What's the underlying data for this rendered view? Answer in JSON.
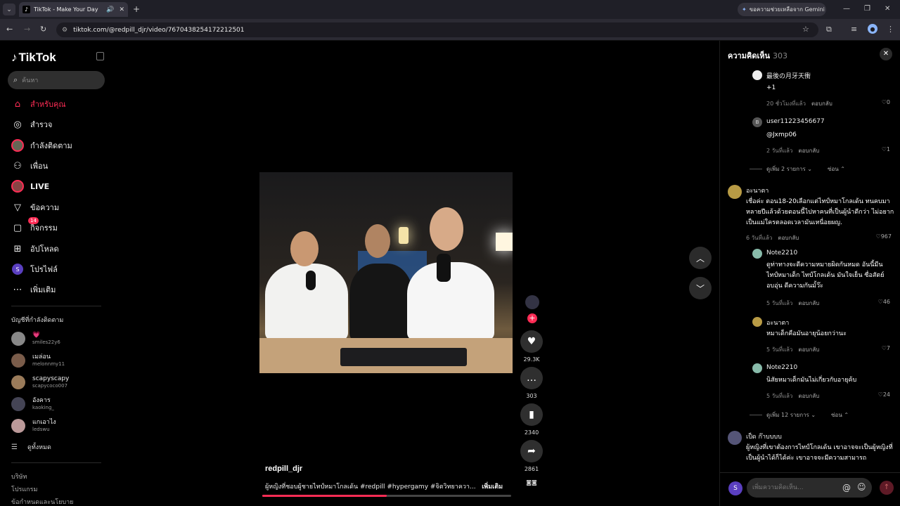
{
  "browser": {
    "tab_title": "TikTok - Make Your Day",
    "url": "tiktok.com/@redpill_djr/video/7670438254172212501",
    "gemini_label": "ขอความช่วยเหลือจาก Gemini"
  },
  "sidebar": {
    "logo_text": "TikTok",
    "search_placeholder": "ค้นหา",
    "nav": [
      {
        "label": "สำหรับคุณ"
      },
      {
        "label": "สำรวจ"
      },
      {
        "label": "กำลังติดตาม"
      },
      {
        "label": "เพื่อน"
      },
      {
        "label": "LIVE"
      },
      {
        "label": "ข้อความ"
      },
      {
        "label": "กิจกรรม",
        "badge": "14"
      },
      {
        "label": "อัปโหลด"
      },
      {
        "label": "โปรไฟล์",
        "initial": "S"
      },
      {
        "label": "เพิ่มเติม"
      }
    ],
    "following_title": "บัญชีที่กำลังติดตาม",
    "following": [
      {
        "name": "💗",
        "handle": "smiles22y6"
      },
      {
        "name": "เมล่อน",
        "handle": "melonnmy11"
      },
      {
        "name": "scapyscapy",
        "handle": "scapycoco007"
      },
      {
        "name": "อังคาร",
        "handle": "kaoking_"
      },
      {
        "name": "แกเอาไง",
        "handle": "ledswu"
      }
    ],
    "see_all": "ดูทั้งหมด",
    "footer": [
      "บริษัท",
      "โปรแกรม",
      "ข้อกำหนดและนโยบาย"
    ]
  },
  "video": {
    "username": "redpill_djr",
    "caption": "ผู้หญิงที่ชอบผู้ชายไทป์หมาโกลเด้น #redpill #hypergamy #จิตวิทยาควา...",
    "more_label": "เพิ่มเติม",
    "progress": 0.5,
    "likes": "29.3K",
    "comments": "303",
    "saves": "2340",
    "shares": "2861"
  },
  "comments": {
    "title": "ความคิดเห็น",
    "count": "303",
    "input_placeholder": "เพิ่มความคิดเห็น...",
    "reply_label": "ตอบกลับ",
    "items": [
      {
        "name": "最後の月牙天衝",
        "text": "+1",
        "time": "20 ชั่วโมงที่แล้ว",
        "likes": "0"
      },
      {
        "name": "user11223456677",
        "text": "@Jxmp06",
        "time": "2 วันที่แล้ว",
        "likes": "1",
        "initial": "B"
      },
      {
        "name": "อะนาตา",
        "text": "เชื่อค่ะ ตอน18-20เลือกแต่ไทป์หมาโกลเด้น ทนคบมาหลายปีแล้วด้วยตอนนี้ไปหาคนที่เป็นผู้นำดีกว่า ไม่อยากเป็นแม่ใครตลอดเวลามันเหนื่อยผญ.",
        "time": "6 วันที่แล้ว",
        "likes": "967"
      },
      {
        "name": "Note2210",
        "text": "ดูท่าทางจะดีความหมายผิดกันหมด อันนี้มีนไทป์หมาเด็ก ไทป์โกลเด้น มันใจเย็น ซื่อสัตย์ อบอุ่น ดีความกันมั้ว๊ะ",
        "time": "5 วันที่แล้ว",
        "likes": "46"
      },
      {
        "name": "อะนาตา",
        "text": "หมาเด็กคือมันอายุน้อยกว่านะ",
        "time": "5 วันที่แล้ว",
        "likes": "7"
      },
      {
        "name": "Note2210",
        "text": "นิสัยหมาเด็กมันไม่เกี่ยวกับอายุค้บ",
        "time": "5 วันที่แล้ว",
        "likes": "24"
      },
      {
        "name": "เป็ด ก๊าบบบบ",
        "text": "ผู้หญิงที่เขาต้องการไทป์โกลเด้น เขาอาจจะเป็นผู้หญิงที่เป็นผู้นำได้ก็ได้ค่ะ เขาอาจจะมีความสามารถ"
      }
    ],
    "view_more_1": "ดูเพิ่ม 2 รายการ",
    "view_more_2": "ดูเพิ่ม 12 รายการ",
    "hide_label": "ซ่อน"
  }
}
